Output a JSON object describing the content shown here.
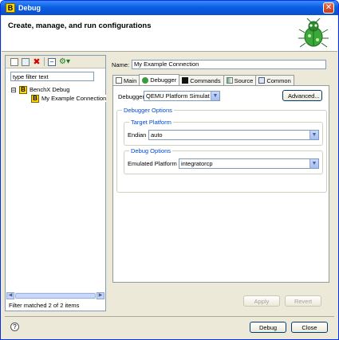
{
  "window": {
    "title": "Debug",
    "close_glyph": "✕",
    "app_icon_letter": "B"
  },
  "banner": {
    "title": "Create, manage, and run configurations",
    "icon": "bug-icon"
  },
  "toolbar": {
    "icons": [
      "new-configuration-icon",
      "duplicate-icon",
      "delete-icon",
      "collapse-all-icon",
      "filter-icon"
    ],
    "delete_glyph": "✖",
    "filter_glyph": "⚙▾"
  },
  "filter": {
    "placeholder": "type filter text",
    "value": "type filter text"
  },
  "tree": {
    "expander": "⊟",
    "items": [
      {
        "label": "BenchX Debug",
        "icon_letter": "B"
      },
      {
        "label": "My Example Connection",
        "icon_letter": "B"
      }
    ]
  },
  "filter_status": "Filter matched 2 of 2 items",
  "name": {
    "label": "Name:",
    "value": "My Example Connection"
  },
  "tabs": [
    {
      "label": "Main"
    },
    {
      "label": "Debugger"
    },
    {
      "label": "Commands"
    },
    {
      "label": "Source"
    },
    {
      "label": "Common"
    }
  ],
  "debugger_tab": {
    "debugger_label": "Debugger:",
    "debugger_value": "QEMU Platform Simulat",
    "advanced_label": "Advanced...",
    "options_title": "Debugger Options",
    "target_platform_title": "Target Platform",
    "endian_label": "Endian",
    "endian_value": "auto",
    "debug_options_title": "Debug Options",
    "emulated_platform_label": "Emulated Platform",
    "emulated_platform_value": "integratorcp"
  },
  "actions": {
    "apply": "Apply",
    "revert": "Revert",
    "debug": "Debug",
    "close": "Close"
  },
  "help_glyph": "?",
  "scroll": {
    "left": "◀",
    "right": "▶",
    "down": "▼"
  },
  "colors": {
    "titlebar": "#0a5ee0",
    "group_title": "#0046d5",
    "bug_green": "#3aa83a"
  }
}
